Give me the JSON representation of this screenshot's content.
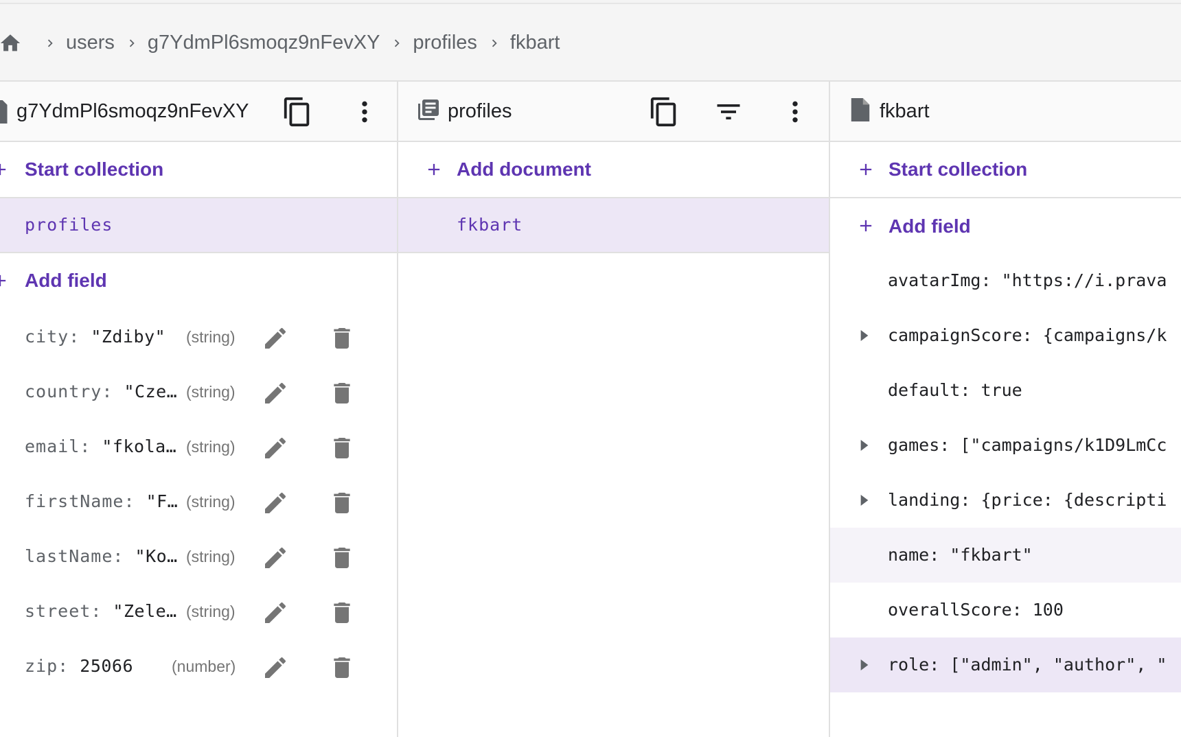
{
  "breadcrumb": {
    "items": [
      "users",
      "g7YdmPl6smoqz9nFevXY",
      "profiles",
      "fkbart"
    ]
  },
  "panel1": {
    "title": "g7YdmPl6smoqz9nFevXY",
    "start_collection_label": "Start collection",
    "collection": "profiles",
    "add_field_label": "Add field",
    "fields": [
      {
        "key": "city",
        "value": "\"Zdiby\"",
        "type": "(string)"
      },
      {
        "key": "country",
        "value": "\"Cze…",
        "type": "(string)"
      },
      {
        "key": "email",
        "value": "\"fkola…",
        "type": "(string)"
      },
      {
        "key": "firstName",
        "value": "\"F…",
        "type": "(string)"
      },
      {
        "key": "lastName",
        "value": "\"Ko…",
        "type": "(string)"
      },
      {
        "key": "street",
        "value": "\"Zele…",
        "type": "(string)"
      },
      {
        "key": "zip",
        "value": "25066",
        "type": "(number)"
      }
    ]
  },
  "panel2": {
    "title": "profiles",
    "add_document_label": "Add document",
    "document": "fkbart"
  },
  "panel3": {
    "title": "fkbart",
    "start_collection_label": "Start collection",
    "add_field_label": "Add field",
    "fields": [
      {
        "key": "avatarImg",
        "value": "\"https://i.prava"
      },
      {
        "key": "campaignScore",
        "value": "{campaigns/k"
      },
      {
        "key": "default",
        "value": "true"
      },
      {
        "key": "games",
        "value": "[\"campaigns/k1D9LmCc"
      },
      {
        "key": "landing",
        "value": "{price: {descripti"
      },
      {
        "key": "name",
        "value": "\"fkbart\""
      },
      {
        "key": "overallScore",
        "value": "100"
      },
      {
        "key": "role",
        "value": "[\"admin\", \"author\", \""
      }
    ]
  },
  "colors": {
    "accent": "#5e35b1",
    "selected_bg": "#ede7f6",
    "icon_grey": "#757575"
  }
}
